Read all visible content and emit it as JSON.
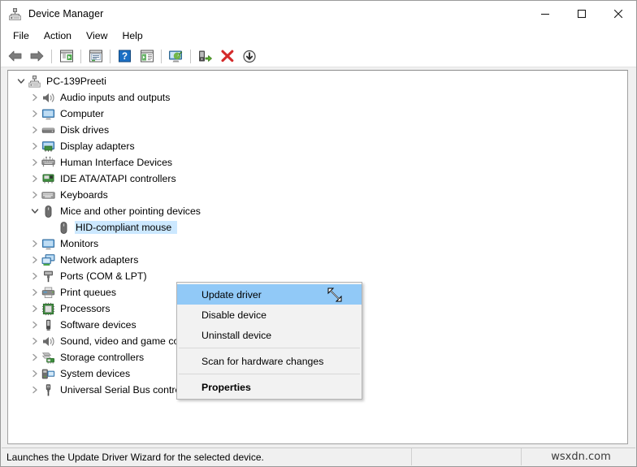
{
  "window": {
    "title": "Device Manager",
    "icon": "device-manager-icon",
    "controls": {
      "minimize": "Minimize",
      "maximize": "Maximize",
      "close": "Close"
    }
  },
  "menubar": {
    "items": [
      {
        "label": "File",
        "name": "menu-file"
      },
      {
        "label": "Action",
        "name": "menu-action"
      },
      {
        "label": "View",
        "name": "menu-view"
      },
      {
        "label": "Help",
        "name": "menu-help"
      }
    ]
  },
  "toolbar": {
    "buttons": [
      {
        "name": "back-icon",
        "tooltip": "Back"
      },
      {
        "name": "forward-icon",
        "tooltip": "Forward"
      },
      {
        "name": "show-hide-console-tree-icon",
        "tooltip": "Show/Hide Console Tree"
      },
      {
        "name": "properties-icon",
        "tooltip": "Properties"
      },
      {
        "name": "help-icon",
        "tooltip": "Help"
      },
      {
        "name": "view-icon",
        "tooltip": "View"
      },
      {
        "name": "scan-hardware-changes-icon",
        "tooltip": "Scan for hardware changes"
      },
      {
        "name": "update-driver-icon",
        "tooltip": "Update driver"
      },
      {
        "name": "uninstall-device-icon",
        "tooltip": "Uninstall device"
      },
      {
        "name": "disable-device-icon",
        "tooltip": "Disable device"
      }
    ]
  },
  "tree": {
    "nodes": [
      {
        "label": "PC-139Preeti",
        "level": 0,
        "state": "expanded",
        "icon": "computer-root-icon",
        "selected": false
      },
      {
        "label": "Audio inputs and outputs",
        "level": 1,
        "state": "collapsed",
        "icon": "speaker-icon",
        "selected": false
      },
      {
        "label": "Computer",
        "level": 1,
        "state": "collapsed",
        "icon": "monitor-icon",
        "selected": false
      },
      {
        "label": "Disk drives",
        "level": 1,
        "state": "collapsed",
        "icon": "disk-drive-icon",
        "selected": false
      },
      {
        "label": "Display adapters",
        "level": 1,
        "state": "collapsed",
        "icon": "display-adapter-icon",
        "selected": false
      },
      {
        "label": "Human Interface Devices",
        "level": 1,
        "state": "collapsed",
        "icon": "hid-icon",
        "selected": false
      },
      {
        "label": "IDE ATA/ATAPI controllers",
        "level": 1,
        "state": "collapsed",
        "icon": "ide-controller-icon",
        "selected": false
      },
      {
        "label": "Keyboards",
        "level": 1,
        "state": "collapsed",
        "icon": "keyboard-icon",
        "selected": false
      },
      {
        "label": "Mice and other pointing devices",
        "level": 1,
        "state": "expanded",
        "icon": "mouse-icon",
        "selected": false
      },
      {
        "label": "HID-compliant mouse",
        "level": 2,
        "state": "leaf",
        "icon": "mouse-icon",
        "selected": true
      },
      {
        "label": "Monitors",
        "level": 1,
        "state": "collapsed",
        "icon": "monitor-icon",
        "selected": false
      },
      {
        "label": "Network adapters",
        "level": 1,
        "state": "collapsed",
        "icon": "network-adapter-icon",
        "selected": false
      },
      {
        "label": "Ports (COM & LPT)",
        "level": 1,
        "state": "collapsed",
        "icon": "port-icon",
        "selected": false
      },
      {
        "label": "Print queues",
        "level": 1,
        "state": "collapsed",
        "icon": "printer-icon",
        "selected": false
      },
      {
        "label": "Processors",
        "level": 1,
        "state": "collapsed",
        "icon": "processor-icon",
        "selected": false
      },
      {
        "label": "Software devices",
        "level": 1,
        "state": "collapsed",
        "icon": "software-device-icon",
        "selected": false
      },
      {
        "label": "Sound, video and game controllers",
        "level": 1,
        "state": "collapsed",
        "icon": "speaker-icon",
        "selected": false
      },
      {
        "label": "Storage controllers",
        "level": 1,
        "state": "collapsed",
        "icon": "storage-controller-icon",
        "selected": false
      },
      {
        "label": "System devices",
        "level": 1,
        "state": "collapsed",
        "icon": "system-device-icon",
        "selected": false
      },
      {
        "label": "Universal Serial Bus controllers",
        "level": 1,
        "state": "collapsed",
        "icon": "usb-icon",
        "selected": false
      }
    ]
  },
  "context_menu": {
    "visible": true,
    "highlighted": "Update driver",
    "cursor": "resize-diagonal-cursor",
    "items": [
      {
        "label": "Update driver",
        "type": "item",
        "highlighted": true,
        "bold": false
      },
      {
        "label": "Disable device",
        "type": "item",
        "highlighted": false,
        "bold": false
      },
      {
        "label": "Uninstall device",
        "type": "item",
        "highlighted": false,
        "bold": false
      },
      {
        "label": "",
        "type": "separator",
        "highlighted": false,
        "bold": false
      },
      {
        "label": "Scan for hardware changes",
        "type": "item",
        "highlighted": false,
        "bold": false
      },
      {
        "label": "",
        "type": "separator",
        "highlighted": false,
        "bold": false
      },
      {
        "label": "Properties",
        "type": "item",
        "highlighted": false,
        "bold": true
      }
    ]
  },
  "statusbar": {
    "message": "Launches the Update Driver Wizard for the selected device.",
    "middle": "",
    "watermark": "wsxdn.com"
  },
  "colors": {
    "selection_blue": "#cce8ff",
    "menu_highlight": "#91c9f7",
    "window_chrome": "#f0f0f0",
    "tree_background": "#ffffff"
  }
}
